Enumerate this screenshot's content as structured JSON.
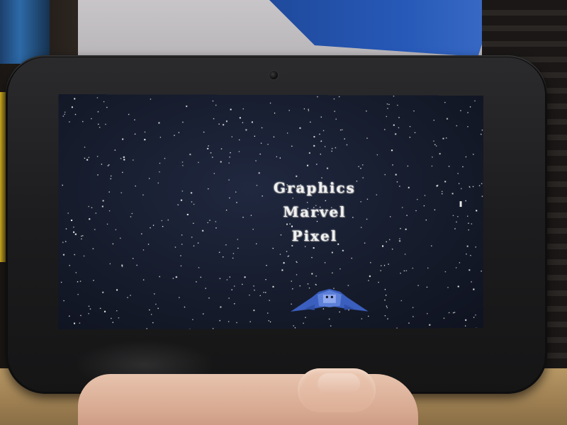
{
  "screen": {
    "title_lines": [
      "Graphics",
      "Marvel",
      "Pixel"
    ]
  },
  "colors": {
    "screen_background": "#161c2c",
    "title_text": "#f1f1f1",
    "ship": "#3b5fbf",
    "tablet_frame": "#1c1c1e"
  },
  "icons": {
    "ship": "spaceship-icon",
    "camera": "front-camera"
  }
}
